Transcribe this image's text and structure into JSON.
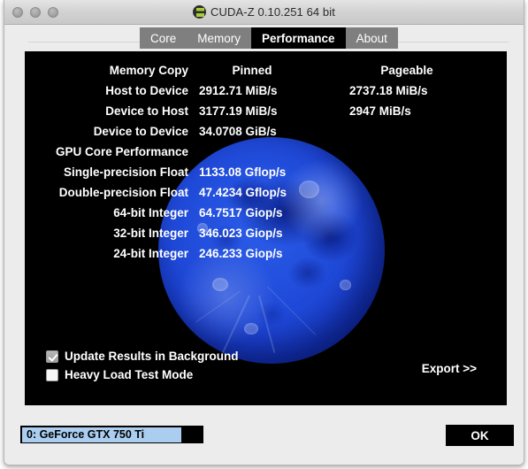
{
  "window": {
    "title": "CUDA-Z 0.10.251 64 bit",
    "app_icon": "cuda-z-logo-icon",
    "traffic_lights": [
      "close",
      "minimize",
      "zoom"
    ]
  },
  "tabs": [
    {
      "label": "Core",
      "active": false
    },
    {
      "label": "Memory",
      "active": false
    },
    {
      "label": "Performance",
      "active": true
    },
    {
      "label": "About",
      "active": false
    }
  ],
  "performance": {
    "columns": {
      "label": "",
      "pinned": "Pinned",
      "pageable": "Pageable"
    },
    "rows": [
      {
        "label": "Memory Copy",
        "pinned": "Pinned",
        "pageable": "Pageable",
        "header": true
      },
      {
        "label": "Host to Device",
        "pinned": "2912.71 MiB/s",
        "pageable": "2737.18 MiB/s",
        "header": false
      },
      {
        "label": "Device to Host",
        "pinned": "3177.19 MiB/s",
        "pageable": "2947 MiB/s",
        "header": false
      },
      {
        "label": "Device to Device",
        "pinned": "34.0708 GiB/s",
        "pageable": "",
        "header": false
      },
      {
        "label": "GPU Core Performance",
        "pinned": "",
        "pageable": "",
        "header": false
      },
      {
        "label": "Single-precision Float",
        "pinned": "1133.08 Gflop/s",
        "pageable": "",
        "header": false
      },
      {
        "label": "Double-precision Float",
        "pinned": "47.4234 Gflop/s",
        "pageable": "",
        "header": false
      },
      {
        "label": "64-bit Integer",
        "pinned": "64.7517 Giop/s",
        "pageable": "",
        "header": false
      },
      {
        "label": "32-bit Integer",
        "pinned": "346.023 Giop/s",
        "pageable": "",
        "header": false
      },
      {
        "label": "24-bit Integer",
        "pinned": "246.233 Giop/s",
        "pageable": "",
        "header": false
      }
    ]
  },
  "options": [
    {
      "label": "Update Results in Background",
      "checked": true
    },
    {
      "label": "Heavy Load Test Mode",
      "checked": false
    }
  ],
  "export": {
    "label": "Export >>"
  },
  "device_selector": {
    "value": "0: GeForce GTX 750 Ti"
  },
  "footer": {
    "ok_label": "OK"
  },
  "colors": {
    "panel_background": "#000000",
    "window_chrome": "#ececec",
    "tab_inactive": "#7f7f7f",
    "tab_active": "#000000",
    "text_on_panel": "#ffffff",
    "selection_highlight": "#aacdf0",
    "logo_green": "#a6ce39",
    "moon_blue": "#1f49d8"
  }
}
